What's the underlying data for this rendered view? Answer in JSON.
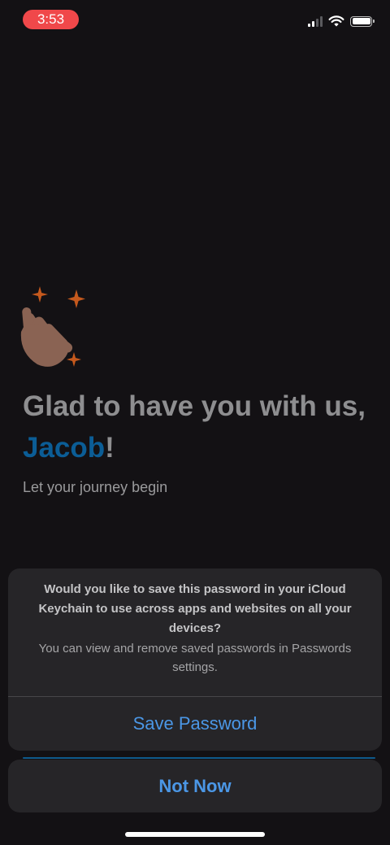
{
  "status_bar": {
    "time": "3:53"
  },
  "welcome": {
    "emoji": "waving-hand-icon",
    "headline_prefix": "Glad to have you with us, ",
    "name": "Jacob",
    "headline_suffix": "!",
    "subtitle": "Let your journey begin"
  },
  "password_prompt": {
    "question": "Would you like to save this password in your iCloud Keychain to use across apps and websites on all your devices?",
    "note": "You can view and remove saved passwords in Passwords settings.",
    "save_label": "Save Password",
    "dismiss_label": "Not Now"
  },
  "colors": {
    "background": "#131114",
    "accent_blue": "#4b97e6",
    "name_blue": "#0b5d96",
    "time_pill": "#f0484a",
    "sheet": "#262528"
  }
}
